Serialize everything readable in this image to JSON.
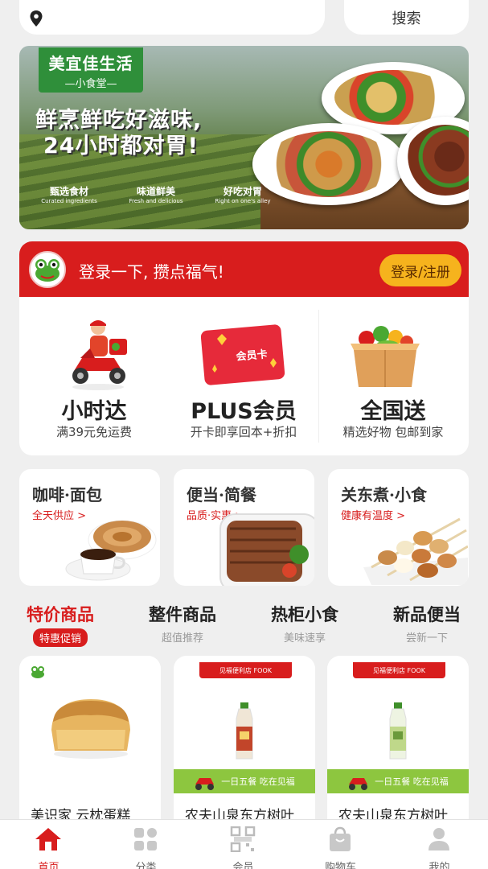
{
  "topbar": {
    "location_icon": "map-pin-icon",
    "search_label": "搜索"
  },
  "banner": {
    "brand_title": "美宜佳生活",
    "brand_sub": "—小食堂—",
    "slogan_line1": "鲜烹鲜吃好滋味,",
    "slogan_line2": "24小时都对胃!",
    "badges": [
      {
        "main": "甄选食材",
        "en": "Curated ingredients"
      },
      {
        "main": "味道鲜美",
        "en": "Fresh and delicious"
      },
      {
        "main": "好吃对胃",
        "en": "Right on one's alley"
      }
    ]
  },
  "login": {
    "prompt": "登录一下, 攒点福气!",
    "button": "登录/注册",
    "avatar_icon": "frog-mascot-icon"
  },
  "services": [
    {
      "title": "小时达",
      "sub": "满39元免运费",
      "icon": "delivery-scooter-icon"
    },
    {
      "title": "PLUS会员",
      "sub": "开卡即享回本+折扣",
      "icon": "member-card-icon",
      "card_text": "会员卡"
    },
    {
      "title": "全国送",
      "sub": "精选好物 包邮到家",
      "icon": "produce-box-icon"
    }
  ],
  "categories": [
    {
      "title": "咖啡·面包",
      "sub": "全天供应 >"
    },
    {
      "title": "便当·简餐",
      "sub": "品质·实惠 >"
    },
    {
      "title": "关东煮·小食",
      "sub": "健康有温度 >"
    }
  ],
  "tabs": [
    {
      "label": "特价商品",
      "sub": "特惠促销",
      "active": true
    },
    {
      "label": "整件商品",
      "sub": "超值推荐",
      "active": false
    },
    {
      "label": "热柜小食",
      "sub": "美味速享",
      "active": false
    },
    {
      "label": "新品便当",
      "sub": "尝新一下",
      "active": false
    }
  ],
  "products": [
    {
      "name": "美识家 云枕蛋糕",
      "ribbon": "",
      "band": ""
    },
    {
      "name": "农夫山泉东方树叶",
      "ribbon": "见福便利店 FOOK",
      "band": "一日五餐 吃在见福"
    },
    {
      "name": "农夫山泉东方树叶",
      "ribbon": "见福便利店 FOOK",
      "band": "一日五餐 吃在见福"
    }
  ],
  "bottom_nav": [
    {
      "label": "首页",
      "icon": "home-icon",
      "active": true
    },
    {
      "label": "分类",
      "icon": "category-grid-icon",
      "active": false
    },
    {
      "label": "会员",
      "icon": "member-qr-icon",
      "active": false
    },
    {
      "label": "购物车",
      "icon": "shopping-bag-icon",
      "active": false
    },
    {
      "label": "我的",
      "icon": "profile-icon",
      "active": false
    }
  ],
  "colors": {
    "primary_red": "#d81d1d",
    "accent_yellow": "#f6b31d",
    "brand_green": "#2f8f3a"
  }
}
